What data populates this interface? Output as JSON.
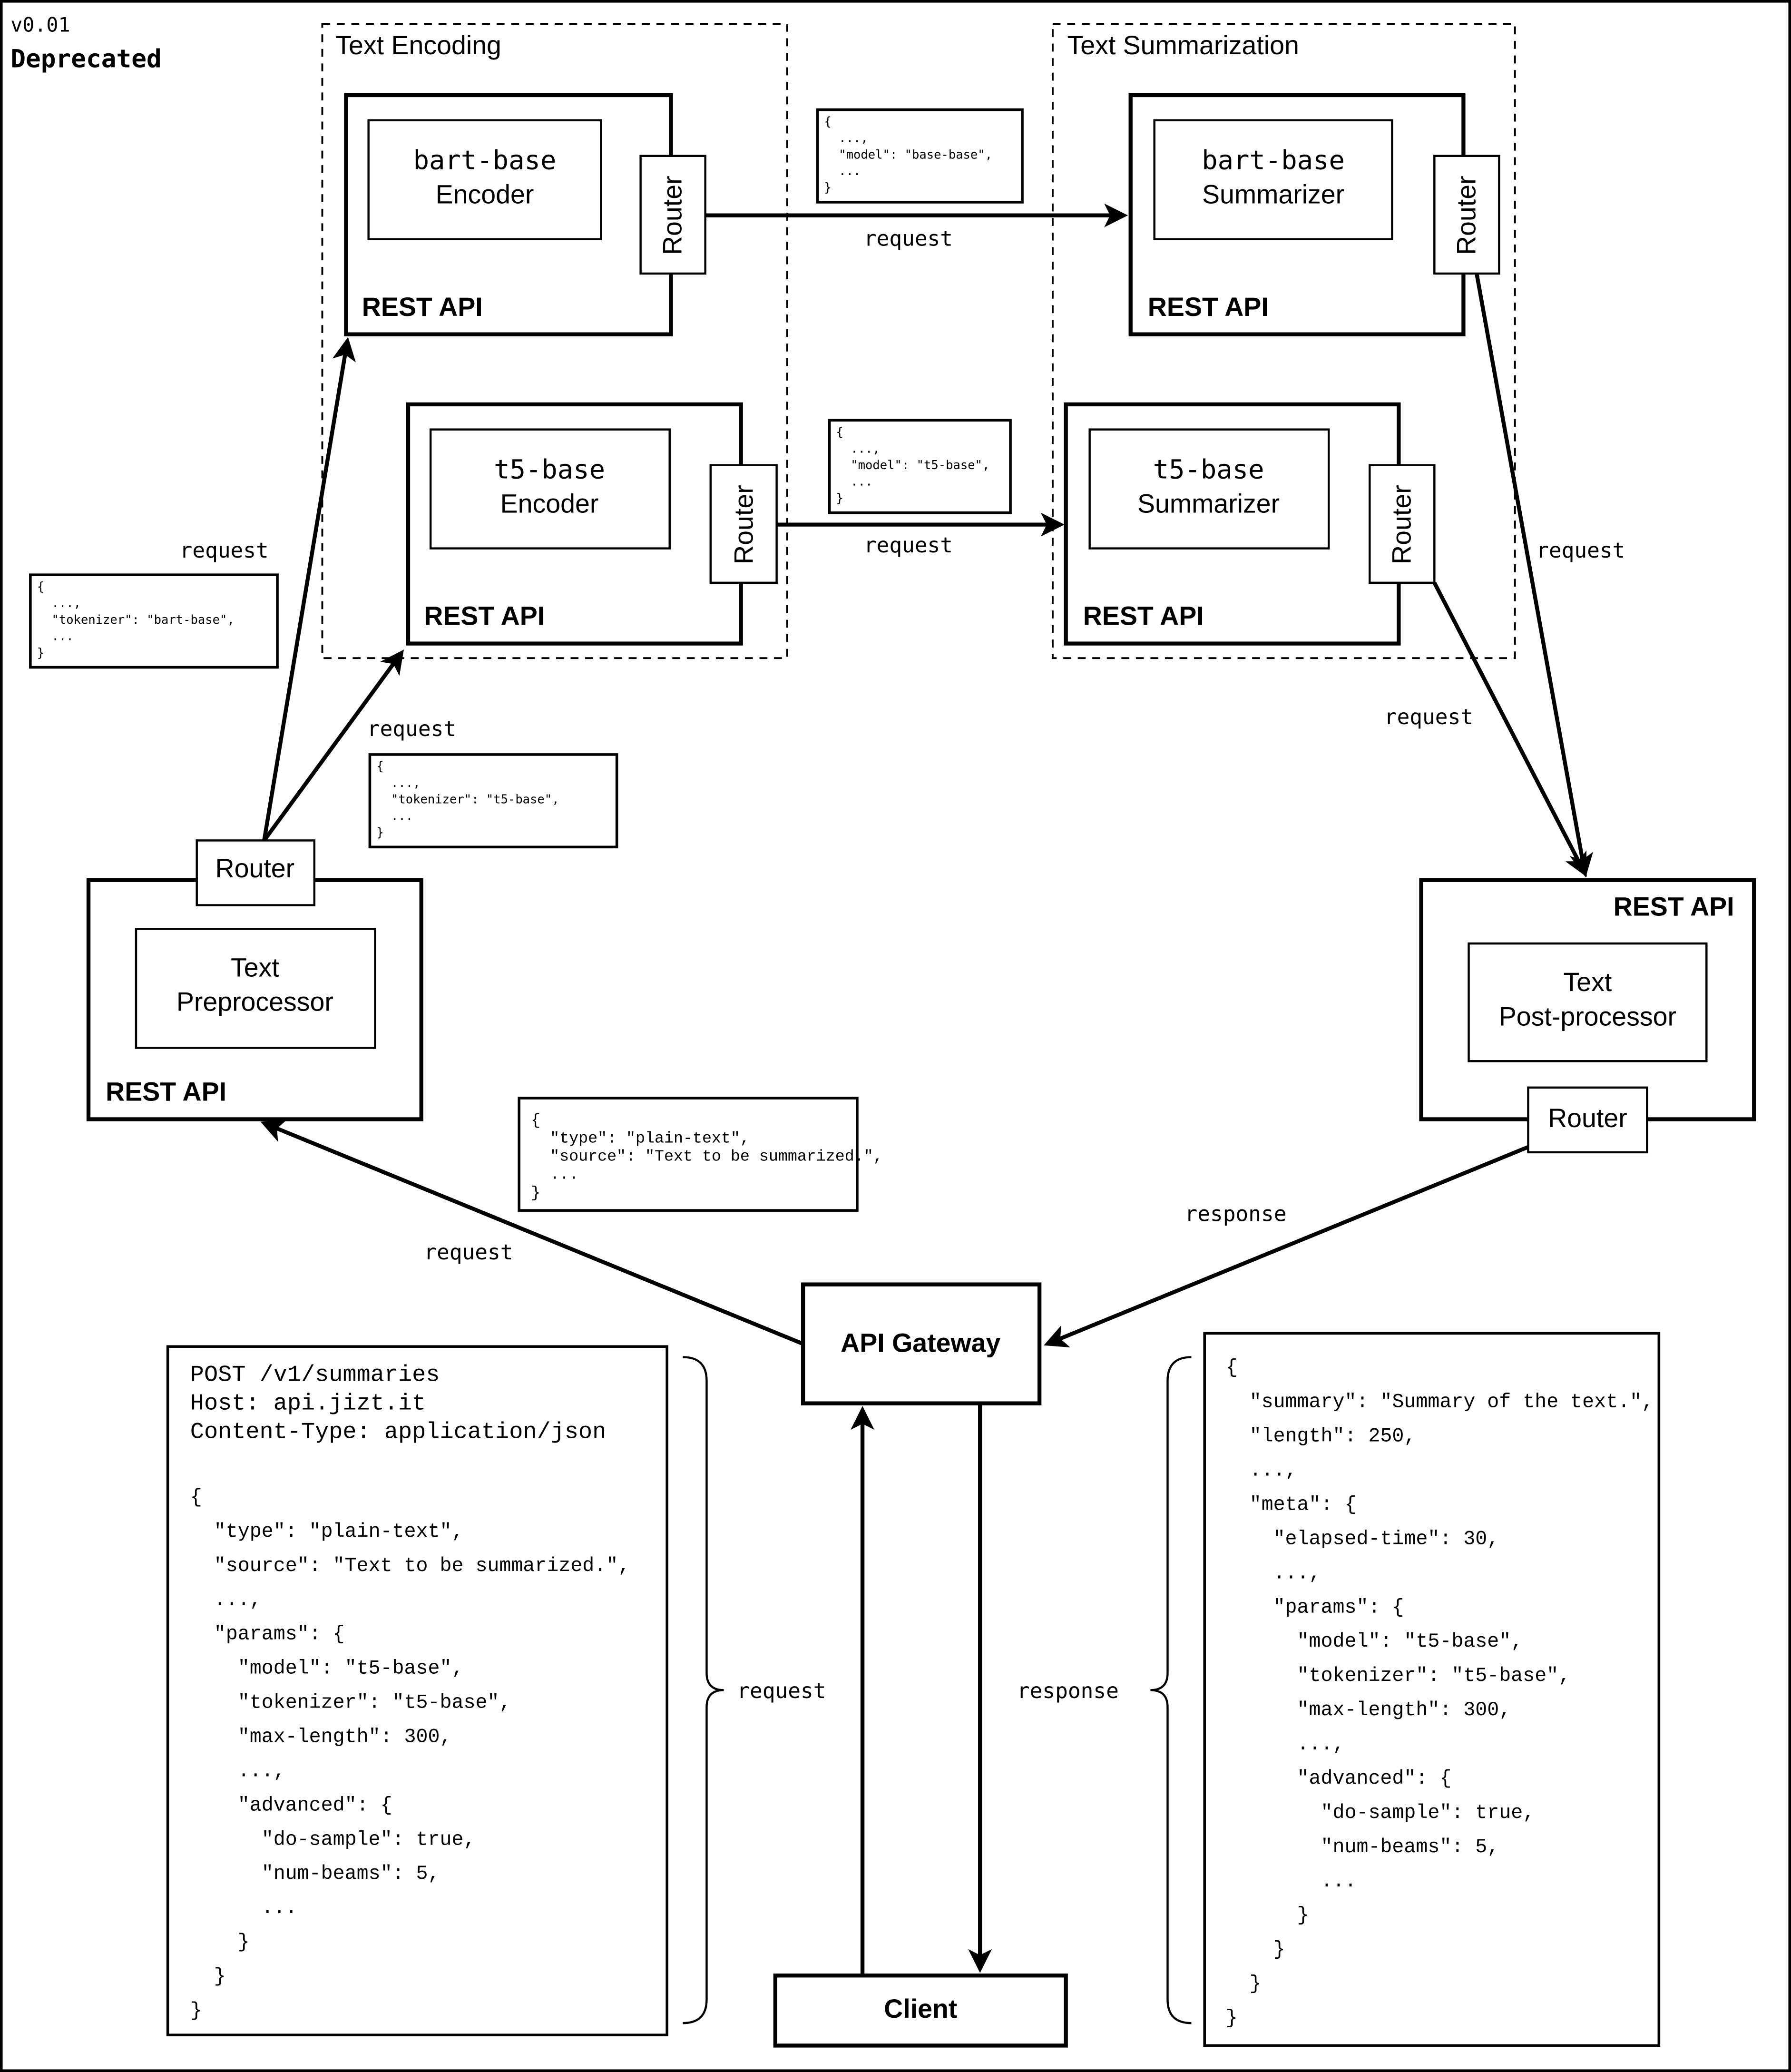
{
  "header": {
    "version": "v0.01",
    "status": "Deprecated"
  },
  "groups": {
    "text_encoding": "Text Encoding",
    "text_summarization": "Text Summarization"
  },
  "common": {
    "rest_api": "REST API",
    "router": "Router",
    "request": "request",
    "response": "response"
  },
  "services": {
    "bart_encoder": {
      "line1": "bart-base",
      "line2": "Encoder"
    },
    "t5_encoder": {
      "line1": "t5-base",
      "line2": "Encoder"
    },
    "bart_summarizer": {
      "line1": "bart-base",
      "line2": "Summarizer"
    },
    "t5_summarizer": {
      "line1": "t5-base",
      "line2": "Summarizer"
    },
    "preprocessor": {
      "line1": "Text",
      "line2": "Preprocessor"
    },
    "postprocessor": {
      "line1": "Text",
      "line2": "Post-processor"
    },
    "api_gateway": "API Gateway",
    "client": "Client"
  },
  "snippets": {
    "model_bart": [
      "{",
      "  ...,",
      "  \"model\": \"base-base\",",
      "  ...",
      "}"
    ],
    "model_t5": [
      "{",
      "  ...,",
      "  \"model\": \"t5-base\",",
      "  ...",
      "}"
    ],
    "tokenizer_bart": [
      "{",
      "  ...,",
      "  \"tokenizer\": \"bart-base\",",
      "  ...",
      "}"
    ],
    "tokenizer_t5": [
      "{",
      "  ...,",
      "  \"tokenizer\": \"t5-base\",",
      "  ...",
      "}"
    ],
    "source": [
      "{",
      "  \"type\": \"plain-text\",",
      "  \"source\": \"Text to be summarized.\",",
      "  ...",
      "}"
    ]
  },
  "http_request": {
    "headers": [
      "POST /v1/summaries",
      "Host: api.jizt.it",
      "Content-Type: application/json"
    ],
    "body": [
      "{",
      "  \"type\": \"plain-text\",",
      "  \"source\": \"Text to be summarized.\",",
      "  ...,",
      "  \"params\": {",
      "    \"model\": \"t5-base\",",
      "    \"tokenizer\": \"t5-base\",",
      "    \"max-length\": 300,",
      "    ...,",
      "    \"advanced\": {",
      "      \"do-sample\": true,",
      "      \"num-beams\": 5,",
      "      ...",
      "    }",
      "  }",
      "}"
    ]
  },
  "http_response": {
    "body": [
      "{",
      "  \"summary\": \"Summary of the text.\",",
      "  \"length\": 250,",
      "  ...,",
      "  \"meta\": {",
      "    \"elapsed-time\": 30,",
      "    ...,",
      "    \"params\": {",
      "      \"model\": \"t5-base\",",
      "      \"tokenizer\": \"t5-base\",",
      "      \"max-length\": 300,",
      "      ...,",
      "      \"advanced\": {",
      "        \"do-sample\": true,",
      "        \"num-beams\": 5,",
      "        ...",
      "      }",
      "    }",
      "  }",
      "}"
    ]
  }
}
